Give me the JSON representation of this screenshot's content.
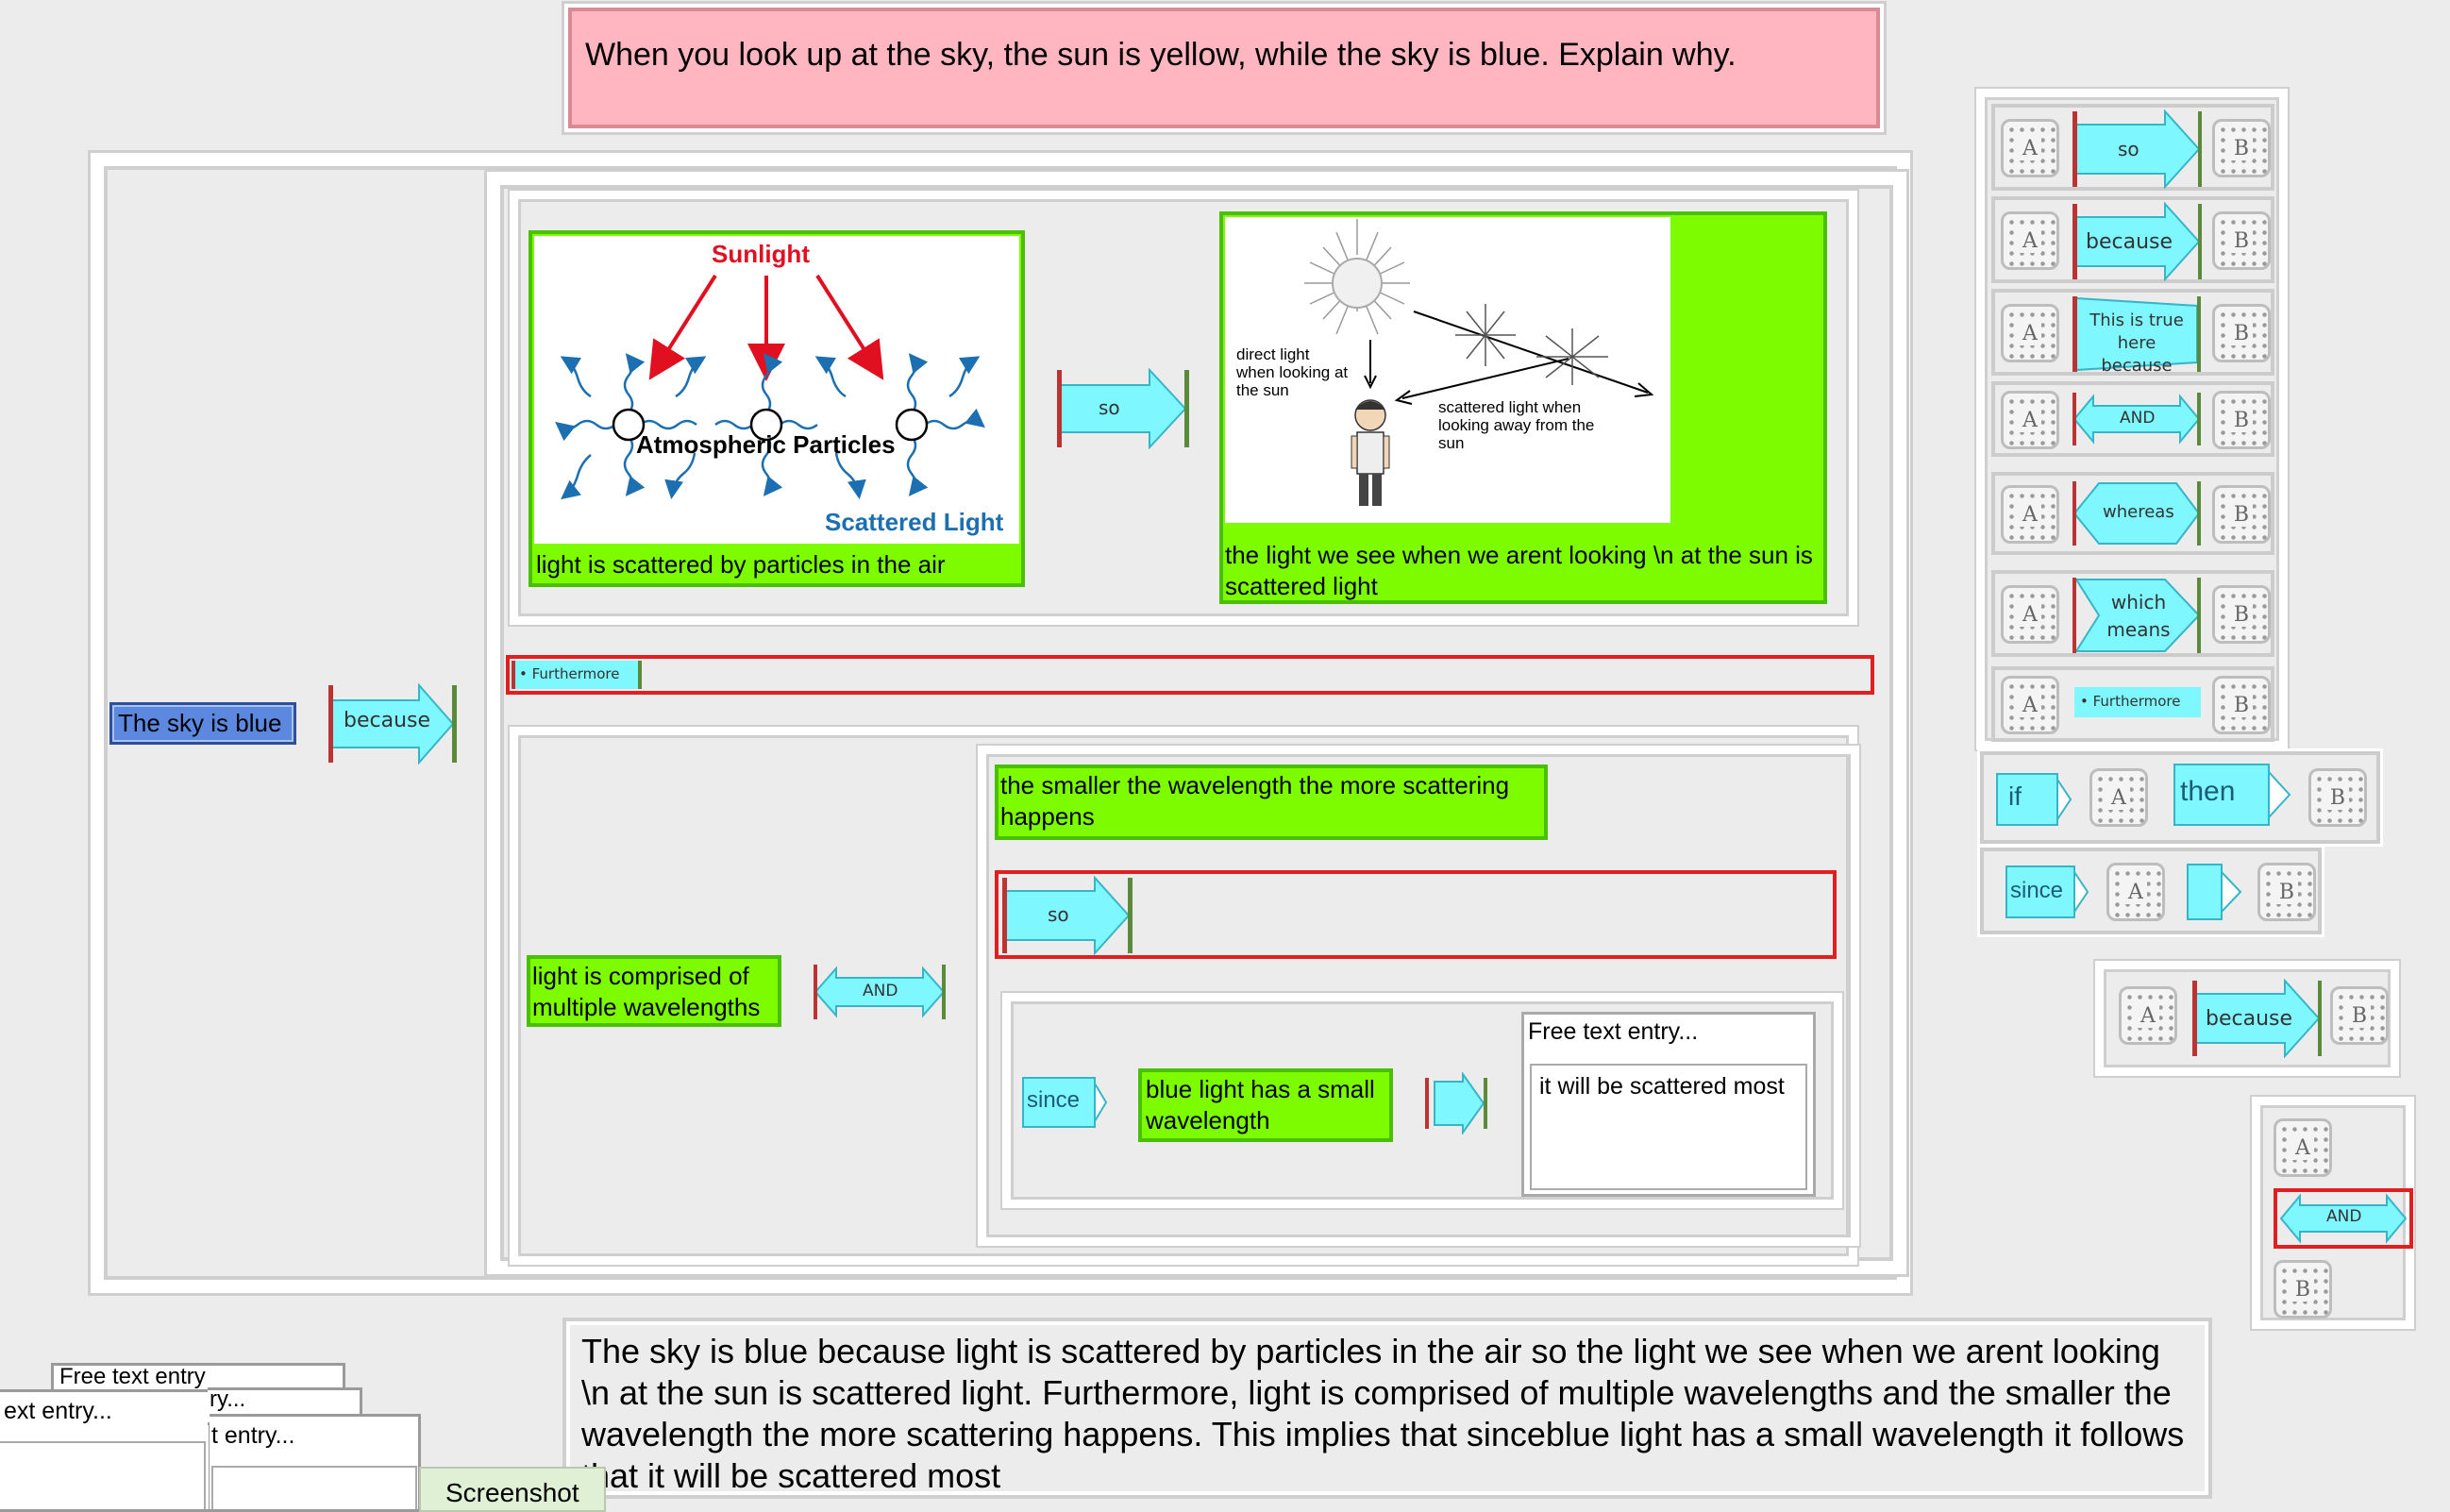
{
  "question": "When you look up at the sky, the sun is yellow, while the sky is blue. Explain why.",
  "main": {
    "claim": "The sky is blue",
    "claim_connector": "because",
    "card1": {
      "image_labels": {
        "sunlight": "Sunlight",
        "particles": "Atmospheric Particles",
        "scattered": "Scattered Light"
      },
      "caption": "light is scattered by particles in the air"
    },
    "card1_connector": "so",
    "card2": {
      "image_labels": {
        "direct": "direct light when looking at the sun",
        "scattered": "scattered light when looking away from the sun"
      },
      "caption": "the light we see when we arent looking \\n at the sun is scattered light"
    },
    "furthermore_label": "• Furthermore",
    "lower": {
      "premise": "light is comprised of multiple wavelengths",
      "and_label": "AND",
      "statement": "the smaller the wavelength the more scattering happens",
      "so_label": "so",
      "since_label": "since",
      "since_premise": "blue light has a small wavelength",
      "free_text": {
        "title": "Free text entry...",
        "value": "it will be scattered most"
      }
    }
  },
  "palette": {
    "tile_a": "A",
    "tile_b": "B",
    "items": [
      "so",
      "because",
      "This is true here because",
      "AND",
      "whereas",
      "which means",
      "• Furthermore"
    ],
    "if_label": "if",
    "then_label": "then",
    "since_label": "since",
    "because_card_label": "because",
    "and_card_label": "AND"
  },
  "answer_text": "The sky is blue because  light is scattered by particles in the air so  the light we see when we arent looking \\n at the sun is scattered light.   Furthermore, light is comprised of multiple wavelengths and the smaller the wavelength the more scattering happens.  This implies that sinceblue light has a small wavelength it follows that it will be scattered most",
  "stacked_windows": [
    "Free text entry",
    "ext entry...",
    "ry...",
    "t entry..."
  ],
  "screenshot_tab": "Screenshot",
  "colors": {
    "background": "#ececec",
    "question_bg": "#ffb6c1",
    "card_green": "#7dfc00",
    "connector_cyan": "#7ff7ff",
    "claim_blue": "#5c88e0",
    "outline_red": "#e02020"
  }
}
